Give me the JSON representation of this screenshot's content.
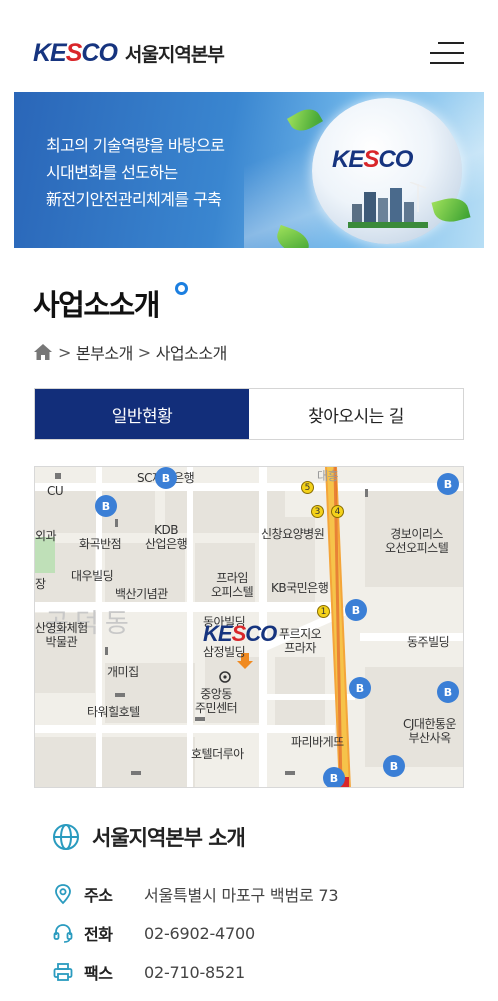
{
  "header": {
    "logo_mark_a": "KE",
    "logo_mark_s": "S",
    "logo_mark_b": "CO",
    "site_name": "서울지역본부"
  },
  "banner": {
    "line1": "최고의 기술역량을 바탕으로",
    "line2": "시대변화를 선도하는",
    "line3": "新전기안전관리체계를 구축",
    "logo_a": "KE",
    "logo_s": "S",
    "logo_b": "CO"
  },
  "page": {
    "title": "사업소소개"
  },
  "breadcrumb": {
    "items": [
      "본부소개",
      "사업소소개"
    ],
    "separator": ">"
  },
  "tabs": [
    {
      "label": "일반현황",
      "active": true
    },
    {
      "label": "찾아오시는 길",
      "active": false
    }
  ],
  "map": {
    "marker_logo_a": "KE",
    "marker_logo_s": "S",
    "marker_logo_b": "CO",
    "district": "공덕동",
    "labels": {
      "sc_bank": "SC제일은행",
      "cu": "CU",
      "daeheung": "대흥",
      "hwagokbanjeom": "화곡반점",
      "kdb_bank": "KDB\n산업은행",
      "sinchang": "신창요양병원",
      "gyeongbo": "경보이리스\n오선오피스텔",
      "daewoo": "대우빌딩",
      "baeksan": "백산기념관",
      "prime": "프라임\n오피스텔",
      "kb": "KB국민은행",
      "sanyeong": "산영화체험\n박물관",
      "dongah": "동아빌딩",
      "prugio": "푸르지오\n프라자",
      "dongju": "동주빌딩",
      "gaemi": "개미집",
      "samjeong": "삼정빌딩",
      "jungang": "중앙동\n주민센터",
      "tower": "타워힐호텔",
      "cj": "CJ대한통운\n부산사옥",
      "paris": "파리바게뜨",
      "hotel": "호텔더루아",
      "oeguk": "외과",
      "jang": "장"
    }
  },
  "info": {
    "title": "서울지역본부 소개",
    "address_label": "주소",
    "address": "서울특별시 마포구 백범로 73",
    "phone_label": "전화",
    "phone": "02-6902-4700",
    "fax_label": "팩스",
    "fax": "02-710-8521"
  },
  "colors": {
    "brand_navy": "#122e7a",
    "brand_red": "#d9262a",
    "accent_blue": "#1c7fe0",
    "icon_teal": "#2a9bbf"
  }
}
